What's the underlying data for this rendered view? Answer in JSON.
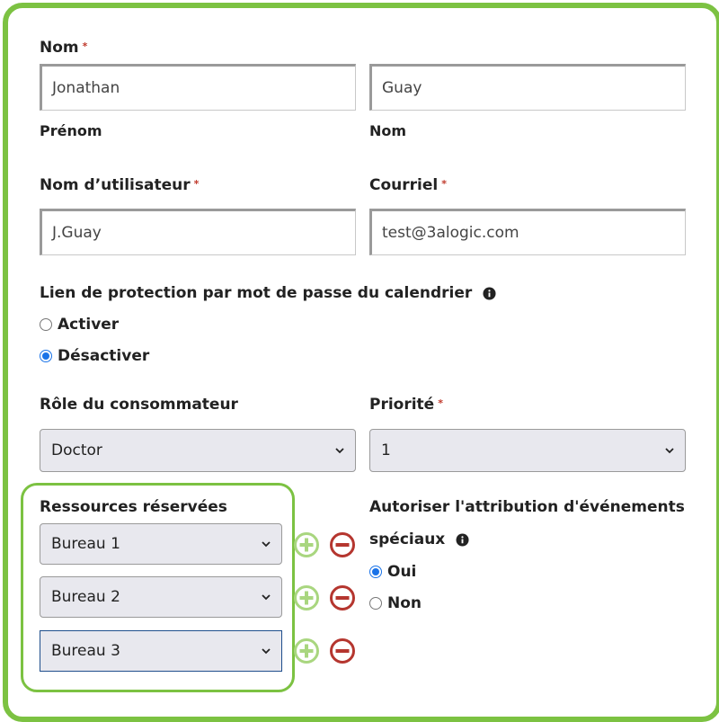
{
  "colors": {
    "accent": "#7cc242",
    "required": "#c0392b",
    "radio": "#1a73e8",
    "remove": "#b5362f"
  },
  "name_section": {
    "label": "Nom",
    "required_mark": "*",
    "first_name_value": "Jonathan",
    "last_name_value": "Guay",
    "first_name_caption": "Prénom",
    "last_name_caption": "Nom"
  },
  "username": {
    "label": "Nom d’utilisateur",
    "required_mark": "*",
    "value": "J.Guay"
  },
  "email": {
    "label": "Courriel",
    "required_mark": "*",
    "value": "test@3alogic.com"
  },
  "calendar_protection": {
    "label": "Lien de protection par mot de passe du calendrier",
    "icon": "info-icon",
    "options": [
      {
        "label": "Activer",
        "checked": false
      },
      {
        "label": "Désactiver",
        "checked": true
      }
    ]
  },
  "consumer_role": {
    "label": "Rôle du consommateur",
    "selected": "Doctor"
  },
  "priority": {
    "label": "Priorité",
    "required_mark": "*",
    "selected": "1"
  },
  "reserved_resources": {
    "label": "Ressources réservées",
    "items": [
      "Bureau 1",
      "Bureau 2",
      "Bureau 3"
    ],
    "add_icon": "plus-circle-icon",
    "remove_icon": "minus-circle-icon"
  },
  "special_events": {
    "label_line1": "Autoriser l'attribution d'événements",
    "label_line2": "spéciaux",
    "icon": "info-icon",
    "options": [
      {
        "label": "Oui",
        "checked": true
      },
      {
        "label": "Non",
        "checked": false
      }
    ]
  }
}
